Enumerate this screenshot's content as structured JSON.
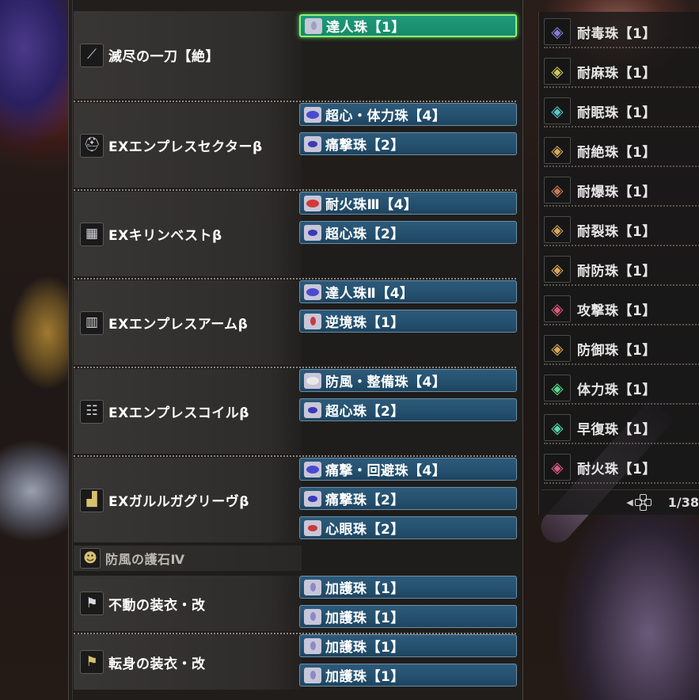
{
  "equipment": [
    {
      "name": "滅尽の一刀【絶】",
      "icon": "sword-icon",
      "slots": [
        {
          "label": "達人珠【1】",
          "size": 1,
          "color": "#9aa0c8",
          "selected": true
        }
      ]
    },
    {
      "name": "EXエンプレスセクターβ",
      "icon": "helm-icon",
      "slots": [
        {
          "label": "超心・体力珠【4】",
          "size": 4,
          "color": "#4a4ad0"
        },
        {
          "label": "痛撃珠【2】",
          "size": 2,
          "color": "#3a3ab8"
        }
      ]
    },
    {
      "name": "EXキリンベストβ",
      "icon": "chest-icon",
      "slots": [
        {
          "label": "耐火珠Ⅲ【4】",
          "size": 4,
          "color": "#d03a3a"
        },
        {
          "label": "超心珠【2】",
          "size": 2,
          "color": "#3a3ab8"
        }
      ]
    },
    {
      "name": "EXエンプレスアームβ",
      "icon": "arm-icon",
      "slots": [
        {
          "label": "達人珠Ⅱ【4】",
          "size": 4,
          "color": "#4a4ad0"
        },
        {
          "label": "逆境珠【1】",
          "size": 1,
          "color": "#c83a3a"
        }
      ]
    },
    {
      "name": "EXエンプレスコイルβ",
      "icon": "waist-icon",
      "slots": [
        {
          "label": "防風・整備珠【4】",
          "size": 4,
          "color": "#e0e0e0"
        },
        {
          "label": "超心珠【2】",
          "size": 2,
          "color": "#3a3ab8"
        }
      ]
    },
    {
      "name": "EXガルルガグリーヴβ",
      "icon": "legs-icon",
      "slots": [
        {
          "label": "痛撃・回避珠【4】",
          "size": 4,
          "color": "#4a4ad0"
        },
        {
          "label": "痛撃珠【2】",
          "size": 2,
          "color": "#3a3ab8"
        },
        {
          "label": "心眼珠【2】",
          "size": 2,
          "color": "#c83a3a"
        }
      ]
    },
    {
      "name": "防風の護石Ⅳ",
      "icon": "charm-icon",
      "slots": []
    },
    {
      "name": "不動の装衣・改",
      "icon": "mantle-icon",
      "slots": [
        {
          "label": "加護珠【1】",
          "size": 1,
          "color": "#8a8ac8"
        },
        {
          "label": "加護珠【1】",
          "size": 1,
          "color": "#8a8ac8"
        }
      ]
    },
    {
      "name": "転身の装衣・改",
      "icon": "mantle-icon",
      "slots": [
        {
          "label": "加護珠【1】",
          "size": 1,
          "color": "#8a8ac8"
        },
        {
          "label": "加護珠【1】",
          "size": 1,
          "color": "#8a8ac8"
        }
      ]
    }
  ],
  "decorations": [
    {
      "label": "耐毒珠【1】",
      "color": "#8a7ad8"
    },
    {
      "label": "耐麻珠【1】",
      "color": "#c8c85a"
    },
    {
      "label": "耐眠珠【1】",
      "color": "#5ac8c8"
    },
    {
      "label": "耐絶珠【1】",
      "color": "#d8a85a"
    },
    {
      "label": "耐爆珠【1】",
      "color": "#c87a5a"
    },
    {
      "label": "耐裂珠【1】",
      "color": "#d8a85a"
    },
    {
      "label": "耐防珠【1】",
      "color": "#d8a85a"
    },
    {
      "label": "攻撃珠【1】",
      "color": "#d85a7a"
    },
    {
      "label": "防御珠【1】",
      "color": "#d8a85a"
    },
    {
      "label": "体力珠【1】",
      "color": "#5ad88a"
    },
    {
      "label": "早復珠【1】",
      "color": "#5ad8a8"
    },
    {
      "label": "耐火珠【1】",
      "color": "#d85a8a"
    }
  ],
  "pager": {
    "text": "1/38"
  }
}
